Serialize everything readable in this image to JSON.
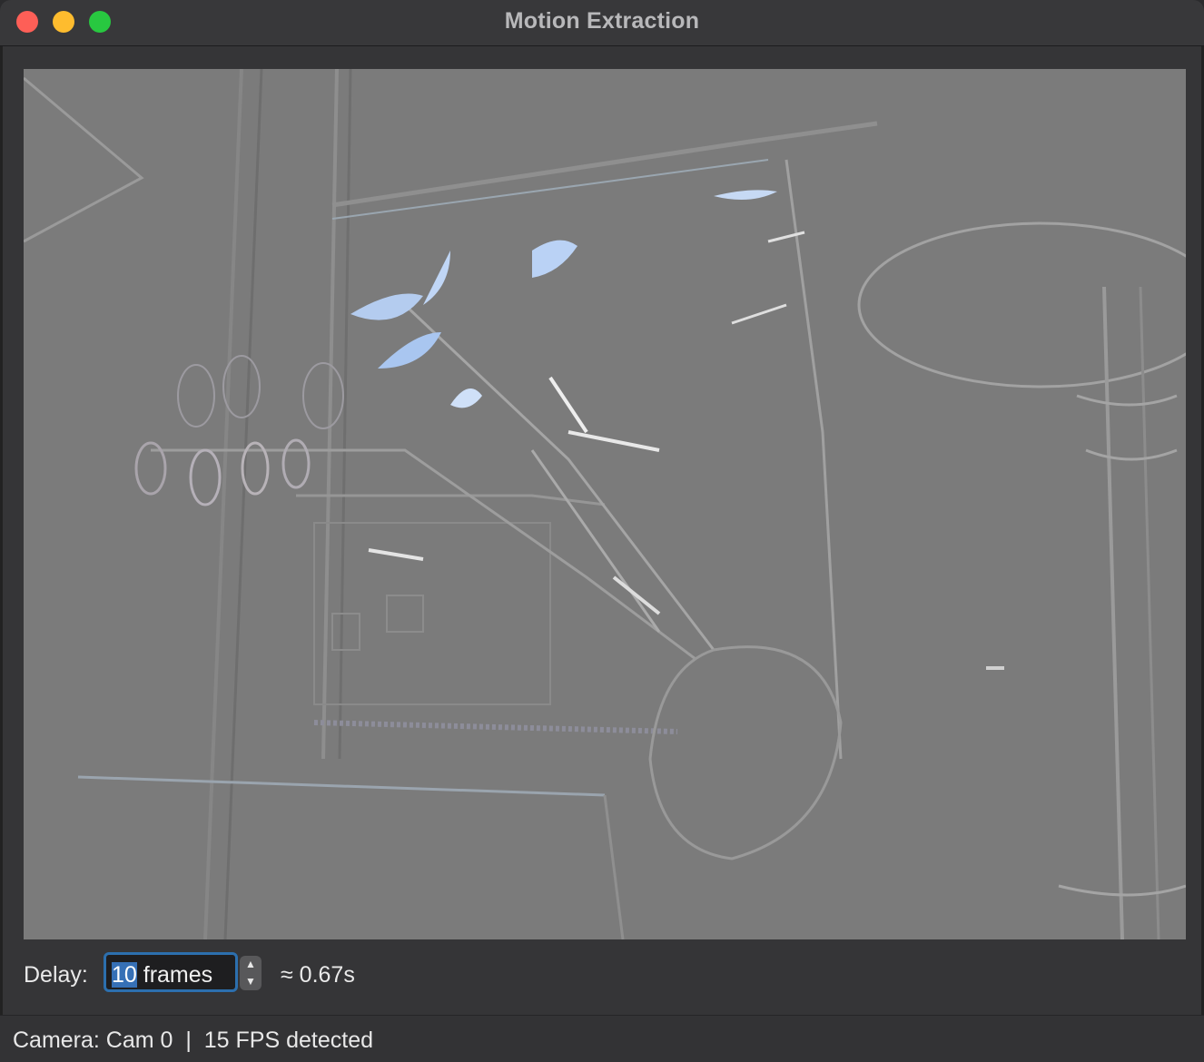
{
  "window": {
    "title": "Motion Extraction"
  },
  "icons": {
    "close": "red-circle",
    "minimize": "yellow-circle",
    "zoom": "green-circle",
    "stepper_up": "chevron-up",
    "stepper_down": "chevron-down"
  },
  "controls": {
    "delay_label": "Delay:",
    "delay_value": "10",
    "delay_unit": " frames",
    "approx_text": "≈ 0.67s"
  },
  "status": {
    "camera": "Camera: Cam 0",
    "separator": "|",
    "fps": "15 FPS detected"
  },
  "colors": {
    "accent": "#2c6fae",
    "selection": "#3670b6",
    "close": "#fe5f57",
    "minimize": "#febc2e",
    "zoom": "#28c840"
  }
}
